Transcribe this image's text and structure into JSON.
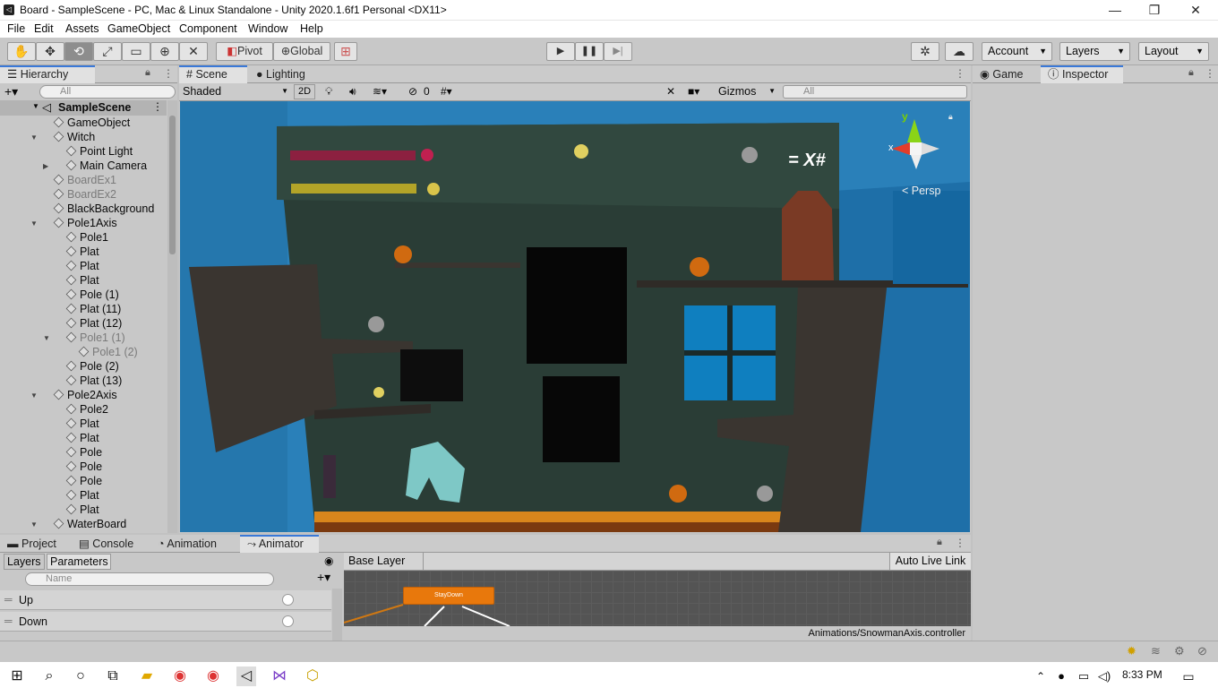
{
  "window": {
    "title": "Board - SampleScene - PC, Mac & Linux Standalone - Unity 2020.1.6f1 Personal <DX11>",
    "min": "—",
    "max": "❐",
    "close": "✕"
  },
  "menu": [
    "File",
    "Edit",
    "Assets",
    "GameObject",
    "Component",
    "Window",
    "Help"
  ],
  "toolbar": {
    "pivot": "Pivot",
    "global": "Global",
    "account": "Account",
    "layers": "Layers",
    "layout": "Layout"
  },
  "hierarchy": {
    "tab": "Hierarchy",
    "search_placeholder": "All",
    "scene": "SampleScene",
    "items": [
      {
        "label": "GameObject",
        "indent": 1,
        "fold": "",
        "disabled": false
      },
      {
        "label": "Witch",
        "indent": 1,
        "fold": "▼",
        "disabled": false
      },
      {
        "label": "Point Light",
        "indent": 2,
        "fold": "",
        "disabled": false
      },
      {
        "label": "Main Camera",
        "indent": 2,
        "fold": "▶",
        "disabled": false
      },
      {
        "label": "BoardEx1",
        "indent": 1,
        "fold": "",
        "disabled": true
      },
      {
        "label": "BoardEx2",
        "indent": 1,
        "fold": "",
        "disabled": true
      },
      {
        "label": "BlackBackground",
        "indent": 1,
        "fold": "",
        "disabled": false
      },
      {
        "label": "Pole1Axis",
        "indent": 1,
        "fold": "▼",
        "disabled": false
      },
      {
        "label": "Pole1",
        "indent": 2,
        "fold": "",
        "disabled": false
      },
      {
        "label": "Plat",
        "indent": 2,
        "fold": "",
        "disabled": false
      },
      {
        "label": "Plat",
        "indent": 2,
        "fold": "",
        "disabled": false
      },
      {
        "label": "Plat",
        "indent": 2,
        "fold": "",
        "disabled": false
      },
      {
        "label": "Pole (1)",
        "indent": 2,
        "fold": "",
        "disabled": false
      },
      {
        "label": "Plat (11)",
        "indent": 2,
        "fold": "",
        "disabled": false
      },
      {
        "label": "Plat (12)",
        "indent": 2,
        "fold": "",
        "disabled": false
      },
      {
        "label": "Pole1 (1)",
        "indent": 2,
        "fold": "▼",
        "disabled": true
      },
      {
        "label": "Pole1 (2)",
        "indent": 3,
        "fold": "",
        "disabled": true
      },
      {
        "label": "Pole (2)",
        "indent": 2,
        "fold": "",
        "disabled": false
      },
      {
        "label": "Plat (13)",
        "indent": 2,
        "fold": "",
        "disabled": false
      },
      {
        "label": "Pole2Axis",
        "indent": 1,
        "fold": "▼",
        "disabled": false
      },
      {
        "label": "Pole2",
        "indent": 2,
        "fold": "",
        "disabled": false
      },
      {
        "label": "Plat",
        "indent": 2,
        "fold": "",
        "disabled": false
      },
      {
        "label": "Plat",
        "indent": 2,
        "fold": "",
        "disabled": false
      },
      {
        "label": "Pole",
        "indent": 2,
        "fold": "",
        "disabled": false
      },
      {
        "label": "Pole",
        "indent": 2,
        "fold": "",
        "disabled": false
      },
      {
        "label": "Pole",
        "indent": 2,
        "fold": "",
        "disabled": false
      },
      {
        "label": "Plat",
        "indent": 2,
        "fold": "",
        "disabled": false
      },
      {
        "label": "Plat",
        "indent": 2,
        "fold": "",
        "disabled": false
      },
      {
        "label": "WaterBoard",
        "indent": 1,
        "fold": "▼",
        "disabled": false
      }
    ]
  },
  "scene": {
    "tabs": [
      "Scene",
      "Lighting"
    ],
    "shading": "Shaded",
    "mode2d": "2D",
    "hidden_count": "0",
    "gizmos": "Gizmos",
    "search_placeholder": "All",
    "persp": "< Persp",
    "axis_x": "x",
    "axis_y": "y",
    "hud_text": "= X#"
  },
  "right": {
    "tabs": [
      "Game",
      "Inspector"
    ]
  },
  "bottom": {
    "tabs": [
      "Project",
      "Console",
      "Animation",
      "Animator"
    ],
    "subtabs": [
      "Layers",
      "Parameters"
    ],
    "name_placeholder": "Name",
    "params": [
      "Up",
      "Down"
    ],
    "base_layer": "Base Layer",
    "auto_live": "Auto Live Link",
    "state": "StayDown",
    "controller_path": "Animations/SnowmanAxis.controller"
  },
  "taskbar": {
    "time": "8:33 PM"
  }
}
